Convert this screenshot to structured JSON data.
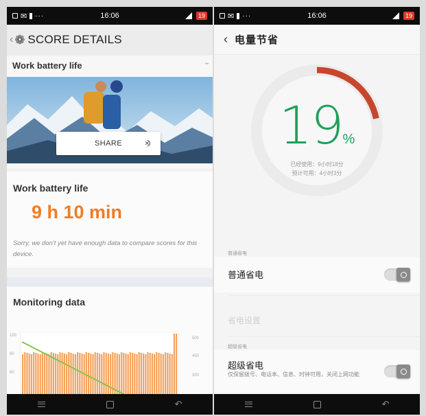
{
  "left": {
    "status": {
      "time": "16:06",
      "icons": [
        "notification-icon",
        "wifi-icon",
        "sim-icon"
      ],
      "battery": "19"
    },
    "header": {
      "title": "SCORE DETAILS"
    },
    "card_battery": {
      "title": "Work battery life",
      "share_label": "SHARE"
    },
    "result": {
      "title": "Work battery life",
      "value": "9 h 10 min",
      "note": "Sorry, we don't yet have enough data to compare scores for this device."
    },
    "monitoring": {
      "title": "Monitoring data",
      "y_left_ticks": [
        "100",
        "80",
        "60"
      ],
      "y_right_ticks": [
        "500",
        "450",
        "300"
      ]
    },
    "accent_color": "#ef7d22"
  },
  "right": {
    "status": {
      "time": "16:06",
      "battery": "19"
    },
    "header": {
      "title": "电量节省"
    },
    "battery": {
      "percent": "19",
      "percent_sign": "%",
      "used": "已经使用：9小时18分",
      "remaining": "预计可用：4小时3分",
      "level_fraction": 0.19
    },
    "section_normal": "普通省电",
    "row_normal": {
      "label": "普通省电"
    },
    "row_settings": {
      "label": "省电设置"
    },
    "section_super": "超级省电",
    "row_super": {
      "label": "超级省电",
      "description": "仅保留拨号、电话本、信息、时钟可用，关闭上网功能"
    },
    "accent_color": "#1fa05a",
    "ring_color": "#c8452e"
  }
}
